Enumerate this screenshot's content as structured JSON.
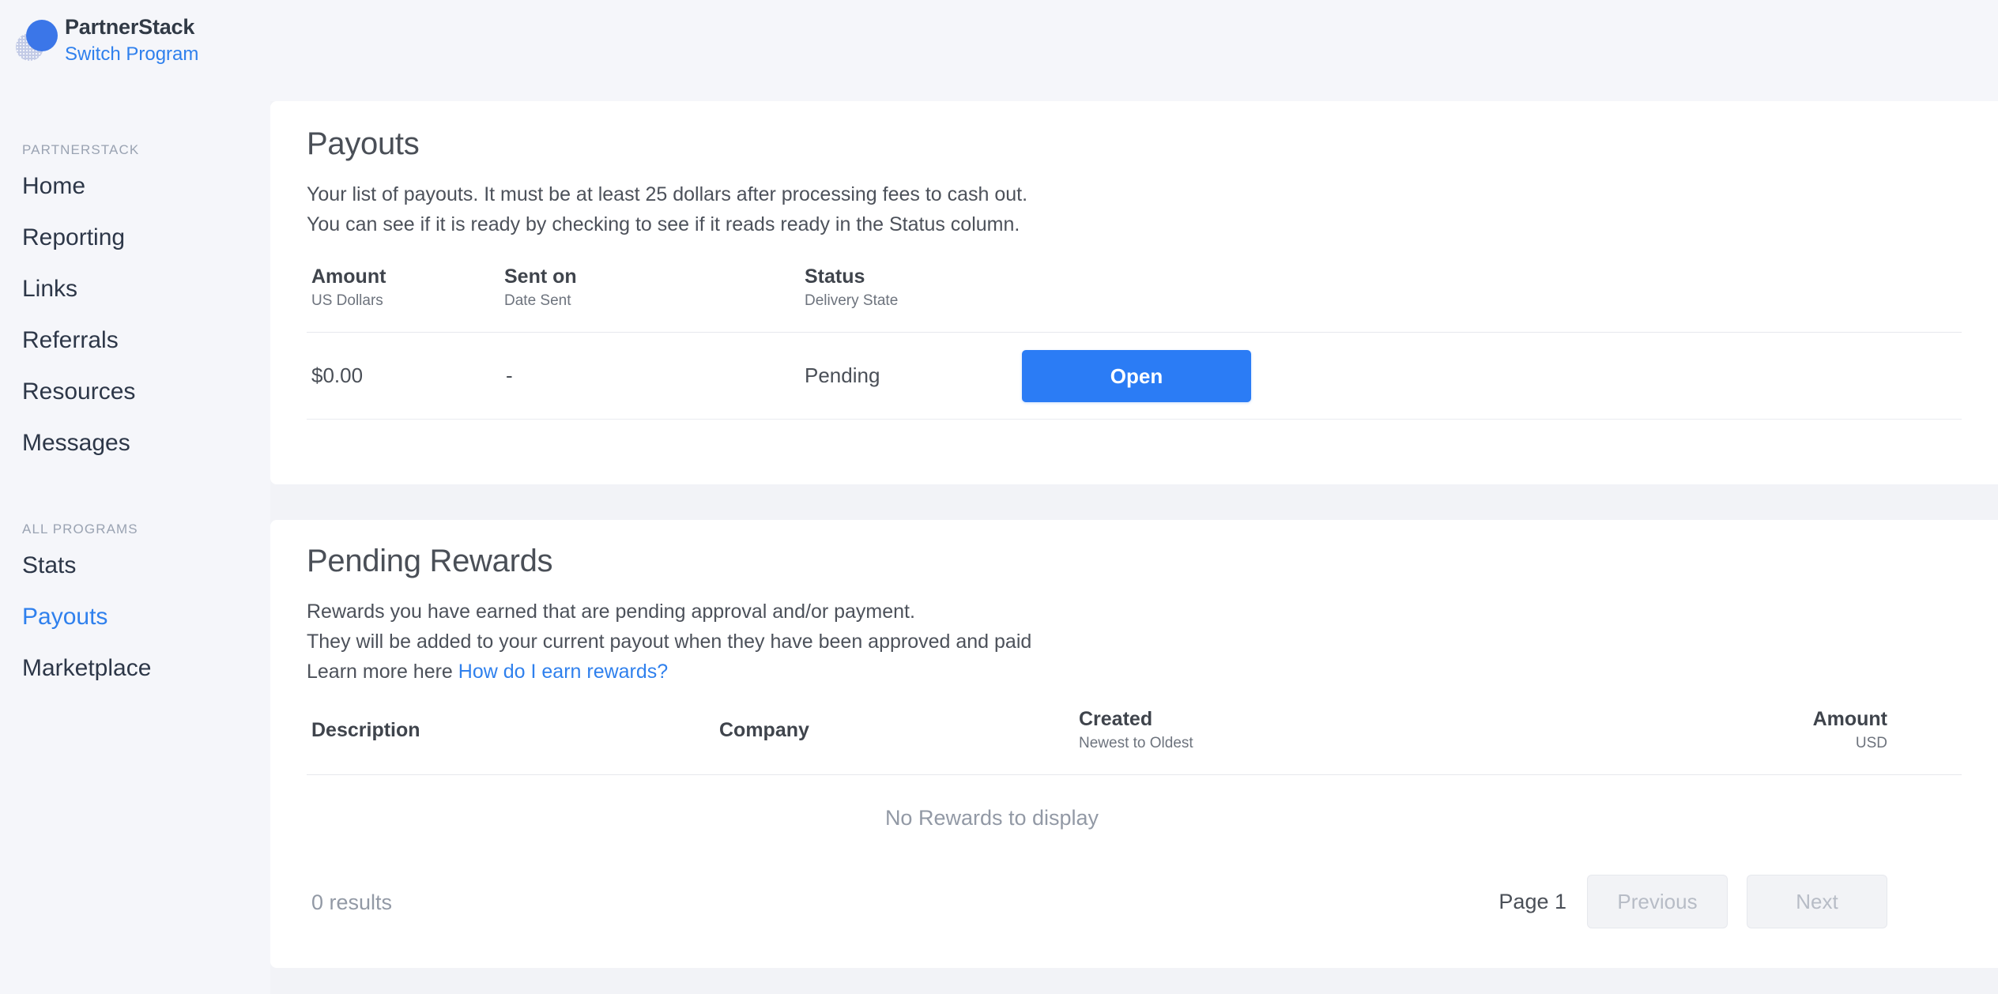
{
  "brand": {
    "name": "PartnerStack",
    "switch_label": "Switch Program",
    "logo_icon": "partnerstack-circles-logo"
  },
  "sidebar": {
    "groups": [
      {
        "heading": "PARTNERSTACK",
        "items": [
          {
            "label": "Home",
            "active": false
          },
          {
            "label": "Reporting",
            "active": false
          },
          {
            "label": "Links",
            "active": false
          },
          {
            "label": "Referrals",
            "active": false
          },
          {
            "label": "Resources",
            "active": false
          },
          {
            "label": "Messages",
            "active": false
          }
        ]
      },
      {
        "heading": "ALL PROGRAMS",
        "items": [
          {
            "label": "Stats",
            "active": false
          },
          {
            "label": "Payouts",
            "active": true
          },
          {
            "label": "Marketplace",
            "active": false
          }
        ]
      }
    ]
  },
  "payouts_card": {
    "title": "Payouts",
    "description_line1": "Your list of payouts. It must be at least 25 dollars after processing fees to cash out.",
    "description_line2": "You can see if it is ready by checking to see if it reads ready in the Status column.",
    "columns": [
      {
        "title": "Amount",
        "sub": "US Dollars"
      },
      {
        "title": "Sent on",
        "sub": "Date Sent"
      },
      {
        "title": "Status",
        "sub": "Delivery State"
      }
    ],
    "rows": [
      {
        "amount": "$0.00",
        "sent_on": "-",
        "status": "Pending",
        "action_label": "Open"
      }
    ]
  },
  "rewards_card": {
    "title": "Pending Rewards",
    "description_line1": "Rewards you have earned that are pending approval and/or payment.",
    "description_line2": "They will be added to your current payout when they have been approved and paid",
    "description_line3_prefix": "Learn more here ",
    "description_link": "How do I earn rewards?",
    "columns": [
      {
        "title": "Description",
        "sub": ""
      },
      {
        "title": "Company",
        "sub": ""
      },
      {
        "title": "Created",
        "sub": "Newest to Oldest"
      },
      {
        "title": "Amount",
        "sub": "USD"
      }
    ],
    "empty_message": "No Rewards to display",
    "results_count": "0 results",
    "page_label": "Page 1",
    "previous_label": "Previous",
    "next_label": "Next"
  },
  "colors": {
    "accent_blue": "#2f80ed",
    "button_blue": "#2b7cf5",
    "sidebar_bg": "#f5f6fa",
    "page_bg": "#f2f3f7"
  }
}
